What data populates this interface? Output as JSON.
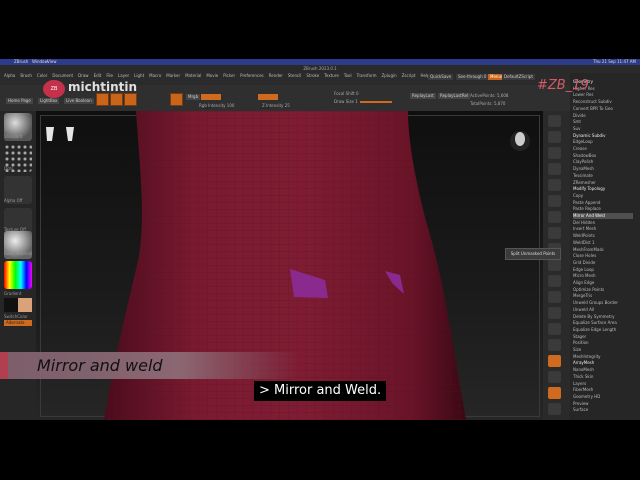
{
  "mac_menu": {
    "app": "ZBrush",
    "window": "Window",
    "view": "View",
    "clock": "Thu 21 Sep 11:47 AM"
  },
  "window_title": "ZBrush 2023.0.1",
  "menus": [
    "Alpha",
    "Brush",
    "Color",
    "Document",
    "Draw",
    "Edit",
    "File",
    "Layer",
    "Light",
    "Macro",
    "Marker",
    "Material",
    "Movie",
    "Picker",
    "Preferences",
    "Render",
    "Stencil",
    "Stroke",
    "Texture",
    "Tool",
    "Transform",
    "Zplugin",
    "Zscript",
    "Help"
  ],
  "toolbar": {
    "home_page": "Home Page",
    "lightbox": "LightBox",
    "live_boolean": "Live Boolean",
    "mrgb": "Mrgb",
    "rgb": "Rgb",
    "m": "M",
    "rgb_intensity": "Rgb Intensity 100",
    "zadd": "Zadd",
    "zsub": "Zsub",
    "z_intensity": "Z Intensity 25",
    "focal_shift": "Focal Shift 0",
    "draw_size": "Draw Size 1",
    "dynamic": "Dynamic",
    "replay_last": "ReplayLast",
    "replay_last_rel": "ReplayLastRel",
    "active_points": "ActivePoints: 5,608",
    "total_points": "TotalPoints: 5,870",
    "quick_save": "QuickSave",
    "see_through": "See-through 0",
    "menus_btn": "Menus",
    "default_zscript": "DefaultZScript"
  },
  "logo": {
    "mark": "ZB",
    "name": "michtintin"
  },
  "hashtag": "#ZB_19",
  "left_tray": {
    "standard": "Standard",
    "dots": "Dots",
    "alpha": "Alpha Off",
    "texture": "Texture Off",
    "material": "Basic Material",
    "gradient": "Gradient",
    "switch_color": "SwitchColor",
    "alternate": "Alternate"
  },
  "right_panel": {
    "geometry": "Geometry",
    "higher_res": "Higher Res",
    "lower_res": "Lower Res",
    "reconstruct_subdiv": "Reconstruct Subdiv",
    "convert_bpr": "Convert BPR To Geo",
    "divide": "Divide",
    "smt": "Smt",
    "suv": "Suv",
    "dynamic_subdiv": "Dynamic Subdiv",
    "edge_loop": "EdgeLoop",
    "crease": "Crease",
    "shadow_box": "ShadowBox",
    "clay_polish": "ClayPolish",
    "dyna_mesh": "DynaMesh",
    "tessimate": "Tessimate",
    "zremesher": "ZRemesher",
    "modify_topology": "Modify Topology",
    "copy": "Copy",
    "paste_append": "Paste Append",
    "paste_replace": "Paste Replace",
    "mirror_and_weld": "Mirror And Weld",
    "del_hidden": "Del Hidden",
    "insert_mesh": "Insert Mesh",
    "weld_points": "WeldPoints",
    "weld_dist": "WeldDist 1",
    "mesh_from_mask": "MeshFromMask",
    "close_holes": "Close Holes",
    "grid_divide": "Grid Divide",
    "edge_loop_2": "Edge Loop",
    "micro_mesh": "Micro Mesh",
    "align_edge": "Align Edge",
    "optimize_points": "Optimize Points",
    "merge_tris": "MergeTris",
    "unweld_groups_border": "Unweld Groups Border",
    "unweld_all": "Unweld All",
    "delete_by_symmetry": "Delete By Symmetry",
    "equalize_surface_area": "Equalize Surface Area",
    "equalize_edge_length": "Equalize Edge Length",
    "stager": "Stager",
    "position": "Position",
    "size": "Size",
    "mesh_integrity": "MeshIntegrity",
    "array_mesh": "ArrayMesh",
    "nano_mesh": "NanoMesh",
    "thick_skin": "Thick Skin",
    "layers": "Layers",
    "fiber_mesh": "FiberMesh",
    "geometry_hd": "Geometry HD",
    "preview": "Preview",
    "surface": "Surface"
  },
  "tooltip": "Split Unmasked Points",
  "banner": "Mirror and weld",
  "subtitle": "> Mirror and Weld."
}
